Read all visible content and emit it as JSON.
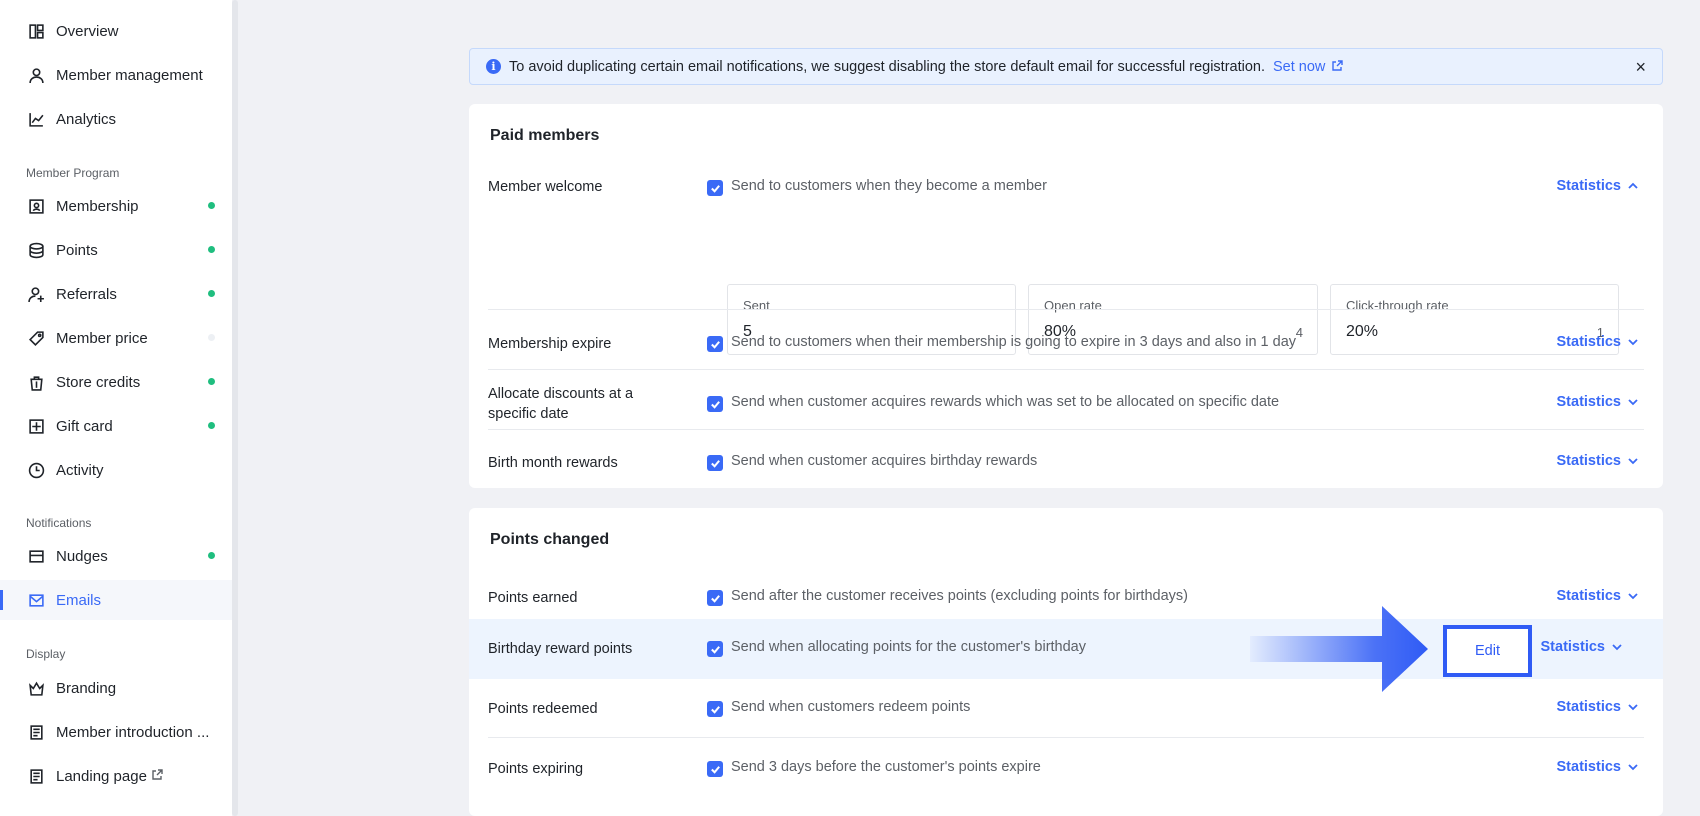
{
  "sidebar": {
    "items_top": [
      {
        "label": "Overview",
        "icon": "overview-icon"
      },
      {
        "label": "Member management",
        "icon": "user-icon"
      },
      {
        "label": "Analytics",
        "icon": "chart-icon"
      }
    ],
    "section_program": "Member Program",
    "items_program": [
      {
        "label": "Membership",
        "icon": "membership-icon"
      },
      {
        "label": "Points",
        "icon": "points-icon"
      },
      {
        "label": "Referrals",
        "icon": "referral-icon"
      },
      {
        "label": "Member price",
        "icon": "tag-icon"
      },
      {
        "label": "Store credits",
        "icon": "store-credit-icon"
      },
      {
        "label": "Gift card",
        "icon": "gift-card-icon"
      },
      {
        "label": "Activity",
        "icon": "clock-icon"
      }
    ],
    "section_notifications": "Notifications",
    "items_notifications": [
      {
        "label": "Nudges",
        "icon": "nudge-icon"
      },
      {
        "label": "Emails",
        "icon": "mail-icon"
      }
    ],
    "section_display": "Display",
    "items_display": [
      {
        "label": "Branding",
        "icon": "crown-icon"
      },
      {
        "label": "Member introduction ...",
        "icon": "page-icon"
      },
      {
        "label": "Landing page",
        "icon": "page-icon"
      }
    ],
    "active_color": "#3a6af6",
    "dot_color": "#1fbe7f"
  },
  "alert": {
    "text": "To avoid duplicating certain email notifications, we suggest disabling the store default email for successful registration.",
    "link": "Set now",
    "close": "×"
  },
  "paid_members": {
    "title": "Paid members",
    "rows": [
      {
        "label": "Member welcome",
        "desc": "Send to customers when they become a member",
        "stat": "Statistics"
      },
      {
        "label": "Membership expire",
        "desc": "Send to customers when their membership is going to expire in 3 days and also in 1 day",
        "stat": "Statistics"
      },
      {
        "label": "Allocate discounts at a specific date",
        "desc": "Send when customer acquires rewards which was set to be allocated on specific date",
        "stat": "Statistics"
      },
      {
        "label": "Birth month rewards",
        "desc": "Send when customer acquires birthday rewards",
        "stat": "Statistics"
      }
    ],
    "stats": [
      {
        "label": "Sent",
        "value": "5",
        "count": ""
      },
      {
        "label": "Open rate",
        "value": "80%",
        "count": "4"
      },
      {
        "label": "Click-through rate",
        "value": "20%",
        "count": "1"
      }
    ]
  },
  "points_changed": {
    "title": "Points changed",
    "rows": [
      {
        "label": "Points earned",
        "desc": "Send after the customer receives points (excluding points for birthdays)",
        "stat": "Statistics"
      },
      {
        "label": "Birthday reward points",
        "desc": "Send when allocating points for the customer's birthday",
        "stat": "Statistics"
      },
      {
        "label": "Points redeemed",
        "desc": "Send when customers redeem points",
        "stat": "Statistics"
      },
      {
        "label": "Points expiring",
        "desc": "Send 3 days before the customer's points expire",
        "stat": "Statistics"
      }
    ],
    "edit": "Edit"
  }
}
